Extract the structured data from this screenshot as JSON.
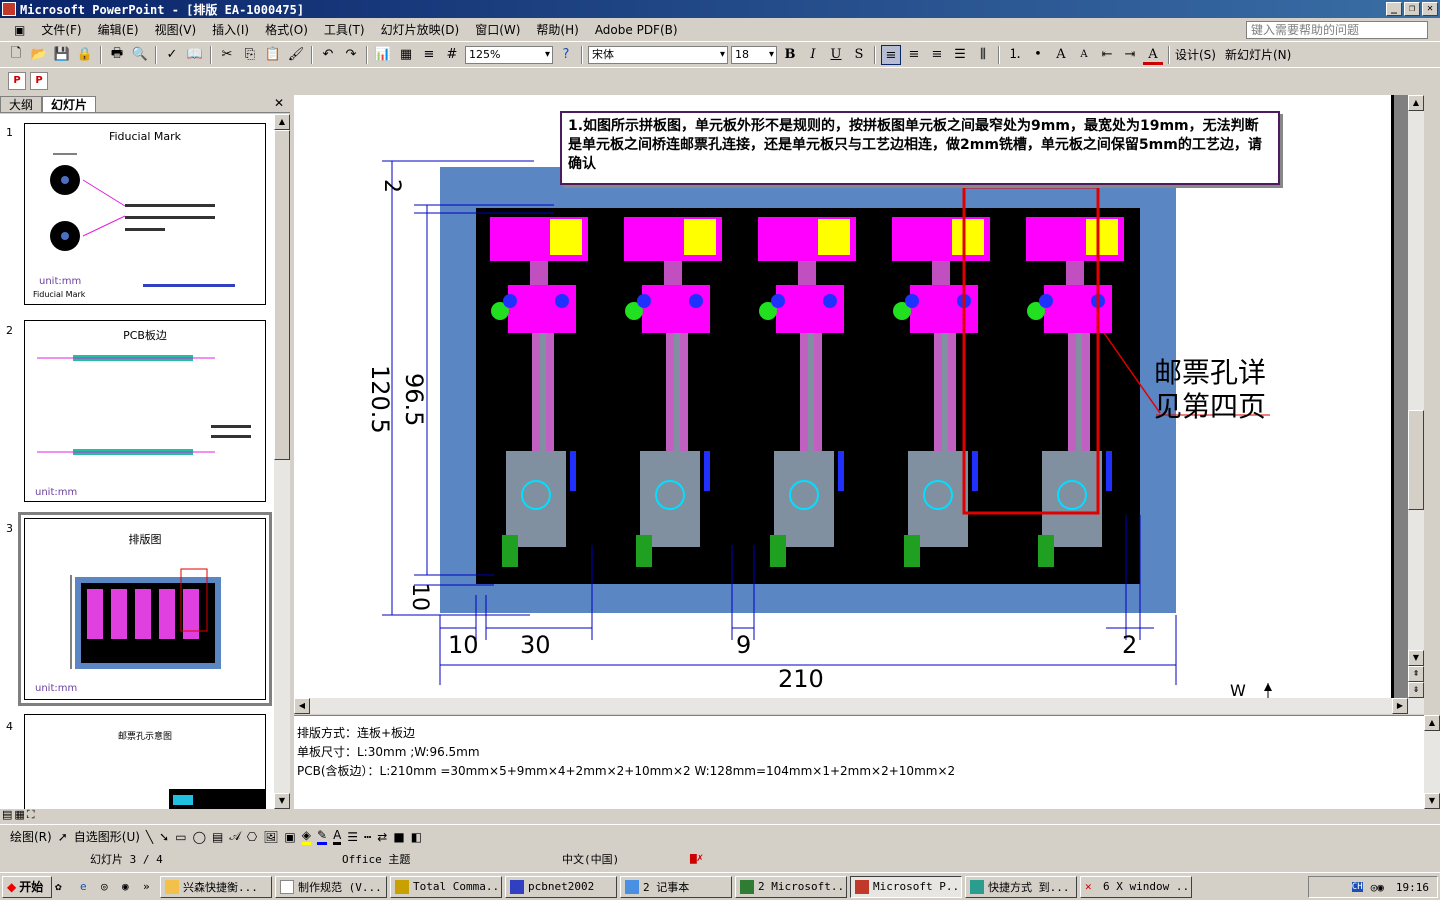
{
  "window": {
    "title": "Microsoft PowerPoint - [排版 EA-1000475]"
  },
  "menu": [
    "文件(F)",
    "编辑(E)",
    "视图(V)",
    "插入(I)",
    "格式(O)",
    "工具(T)",
    "幻灯片放映(D)",
    "窗口(W)",
    "帮助(H)",
    "Adobe PDF(B)"
  ],
  "help": {
    "placeholder": "键入需要帮助的问题"
  },
  "toolbar": {
    "zoom": "125%",
    "font": "宋体",
    "size": "18",
    "design": "设计(S)",
    "new_slide": "新幻灯片(N)"
  },
  "panel": {
    "tab_outline": "大纲",
    "tab_slides": "幻灯片"
  },
  "thumbs": [
    {
      "num": "1",
      "title": "Fiducial Mark",
      "unit": "unit:mm",
      "sub": "Fiducial Mark"
    },
    {
      "num": "2",
      "title": "PCB板边",
      "unit": "unit:mm"
    },
    {
      "num": "3",
      "title": "排版图",
      "unit": "unit:mm"
    },
    {
      "num": "4",
      "title": "邮票孔示意图"
    }
  ],
  "slide": {
    "callout": "1.如图所示拼板图，单元板外形不是规则的，按拼板图单元板之间最窄处为9mm，最宽处为19mm，无法判断是单元板之间桥连邮票孔连接，还是单元板只与工艺边相连，做2mm铣槽，单元板之间保留5mm的工艺边，请确认",
    "side_note_1": "邮票孔详",
    "side_note_2": "见第四页",
    "dims": {
      "top": "2",
      "height_total": "120.5",
      "height_unit": "96.5",
      "bottom": "10",
      "edge": "10",
      "unit_w": "30",
      "gap": "9",
      "slot": "2",
      "total_w": "210",
      "w_label": "W"
    }
  },
  "notes": {
    "line1": "排版方式：连板+板边",
    "line2": "单板尺寸：L:30mm ;W:96.5mm",
    "line3": "PCB(含板边）：L:210mm =30mm×5+9mm×4+2mm×2+10mm×2   W:128mm=104mm×1+2mm×2+10mm×2"
  },
  "drawbar": {
    "draw": "绘图(R)",
    "autoshape": "自选图形(U)"
  },
  "status": {
    "slide": "幻灯片 3 / 4",
    "theme": "Office 主题",
    "lang": "中文(中国)"
  },
  "taskbar": {
    "start": "开始",
    "tasks": [
      "兴森快捷衡...",
      "制作规范 (V...",
      "Total Comma...",
      "pcbnet2002",
      "2 记事本",
      "2 Microsoft...",
      "Microsoft P...",
      "快捷方式 到...",
      "6 X window ..."
    ],
    "clock": "19:16"
  },
  "colors": {
    "board_blue": "#5b86c4",
    "panel_black": "#000000",
    "trace_magenta": "#ff00ff",
    "mark_red": "#e00000"
  }
}
